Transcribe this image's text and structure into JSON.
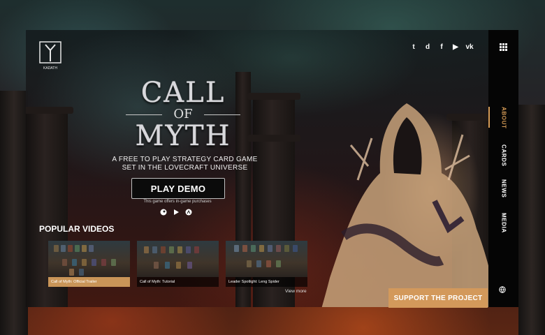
{
  "brand": {
    "logo_text": "KADATH"
  },
  "social": [
    {
      "icon": "twitter-icon",
      "glyph": "t"
    },
    {
      "icon": "discord-icon",
      "glyph": "d"
    },
    {
      "icon": "facebook-icon",
      "glyph": "f"
    },
    {
      "icon": "youtube-icon",
      "glyph": "▶"
    },
    {
      "icon": "vk-icon",
      "glyph": "vk"
    }
  ],
  "hero": {
    "title_top": "CALL",
    "title_mid": "OF",
    "title_bottom": "MYTH",
    "tagline_line1": "A FREE TO PLAY STRATEGY CARD GAME",
    "tagline_line2": "SET IN THE LOVECRAFT UNIVERSE",
    "demo_button": "PLAY DEMO",
    "purchase_note": "This game offers in-game purchases",
    "platforms": [
      "steam-icon",
      "google-play-icon",
      "app-store-icon"
    ]
  },
  "videos": {
    "heading": "POPULAR VIDEOS",
    "items": [
      {
        "caption": "Call of Myth: Official Trailer"
      },
      {
        "caption": "Call of Myth: Tutorial"
      },
      {
        "caption": "Leader Spotlight: Leng Spider"
      }
    ],
    "view_more": "View more"
  },
  "nav": {
    "items": [
      "ABOUT",
      "CARDS",
      "NEWS",
      "MEDIA"
    ],
    "active": "ABOUT"
  },
  "support_button": "SUPPORT THE PROJECT",
  "colors": {
    "accent": "#d3995b",
    "sidebar": "#050505"
  }
}
